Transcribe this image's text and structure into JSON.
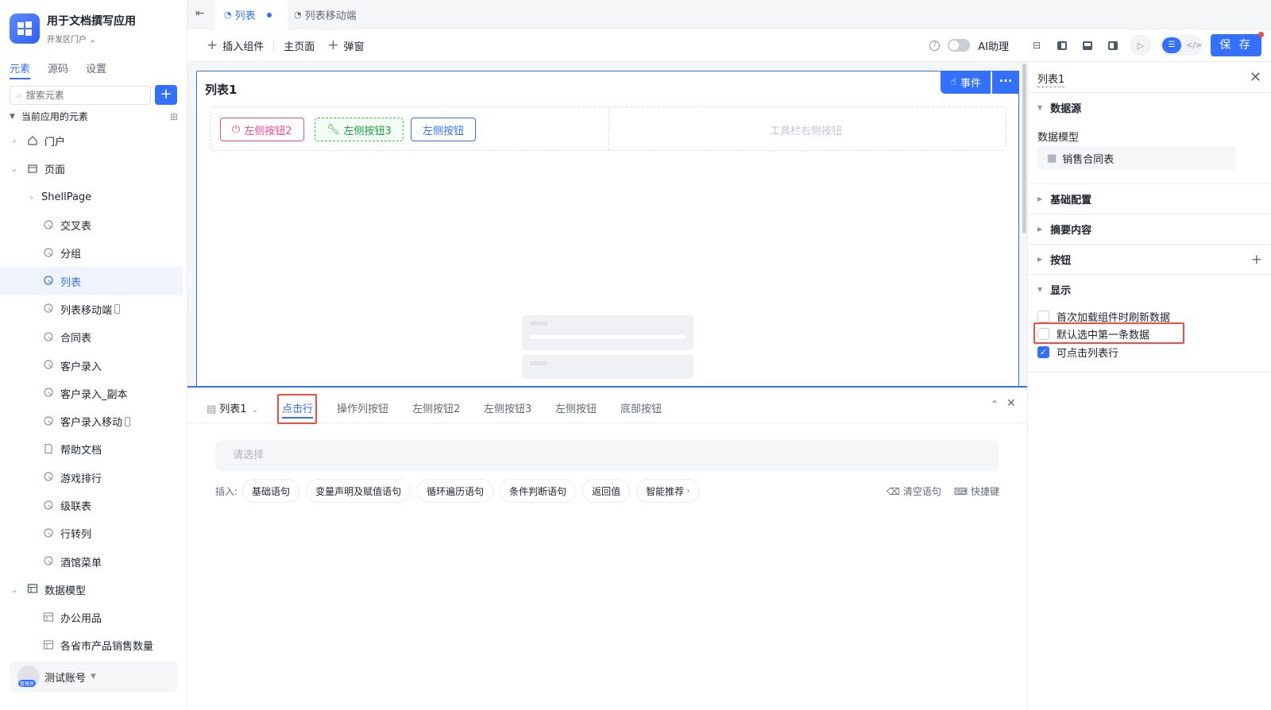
{
  "app": {
    "name": "用于文档撰写应用",
    "portal": "开发区门户"
  },
  "sidebar": {
    "tabs": [
      "元素",
      "源码",
      "设置"
    ],
    "search_placeholder": "搜索元素",
    "tree_header": "当前应用的元素",
    "nodes": {
      "portal": "门户",
      "pages": "页面",
      "shell": "ShellPage",
      "cross": "交叉表",
      "group": "分组",
      "list": "列表",
      "list_mobile": "列表移动端",
      "contract": "合同表",
      "customer": "客户录入",
      "customer_copy": "客户录入_副本",
      "customer_mobile": "客户录入移动",
      "help": "帮助文档",
      "game": "游戏排行",
      "cascade": "级联表",
      "row_to_col": "行转列",
      "bar_menu": "酒馆菜单",
      "data_model": "数据模型",
      "office": "办公用品",
      "province_sales": "各省市产品销售数量"
    },
    "user": {
      "name": "测试账号",
      "role": "管理员"
    }
  },
  "tabs": {
    "active": "列表",
    "second": "列表移动端"
  },
  "toolbar": {
    "insert": "插入组件",
    "main_page": "主页面",
    "popup": "弹窗",
    "ai": "AI助理",
    "save": "保 存"
  },
  "canvas": {
    "list_title": "列表1",
    "event_btn": "事件",
    "more_btn": "···",
    "buttons": {
      "left2": "左侧按钮2",
      "left3": "左侧按钮3",
      "left": "左侧按钮"
    },
    "right_placeholder": "工具栏右侧按钮"
  },
  "bottom_panel": {
    "component": "列表1",
    "tabs": [
      "点击行",
      "操作列按钮",
      "左侧按钮2",
      "左侧按钮3",
      "左侧按钮",
      "底部按钮"
    ],
    "select_placeholder": "请选择",
    "insert_label": "插入:",
    "chips": [
      "基础语句",
      "变量声明及赋值语句",
      "循环遍历语句",
      "条件判断语句",
      "返回值",
      "智能推荐"
    ],
    "clear": "清空语句",
    "shortcut": "快捷键"
  },
  "right_panel": {
    "title": "列表1",
    "sections": {
      "datasource": "数据源",
      "basic": "基础配置",
      "summary": "摘要内容",
      "buttons": "按钮",
      "display": "显示"
    },
    "data_model_label": "数据模型",
    "data_model_value": "销售合同表",
    "options": [
      {
        "label": "首次加载组件时刷新数据",
        "checked": false
      },
      {
        "label": "默认选中第一条数据",
        "checked": false
      },
      {
        "label": "可点击列表行",
        "checked": true
      }
    ]
  },
  "colors": {
    "accent": "#3370ff",
    "highlight": "#f54a45"
  }
}
